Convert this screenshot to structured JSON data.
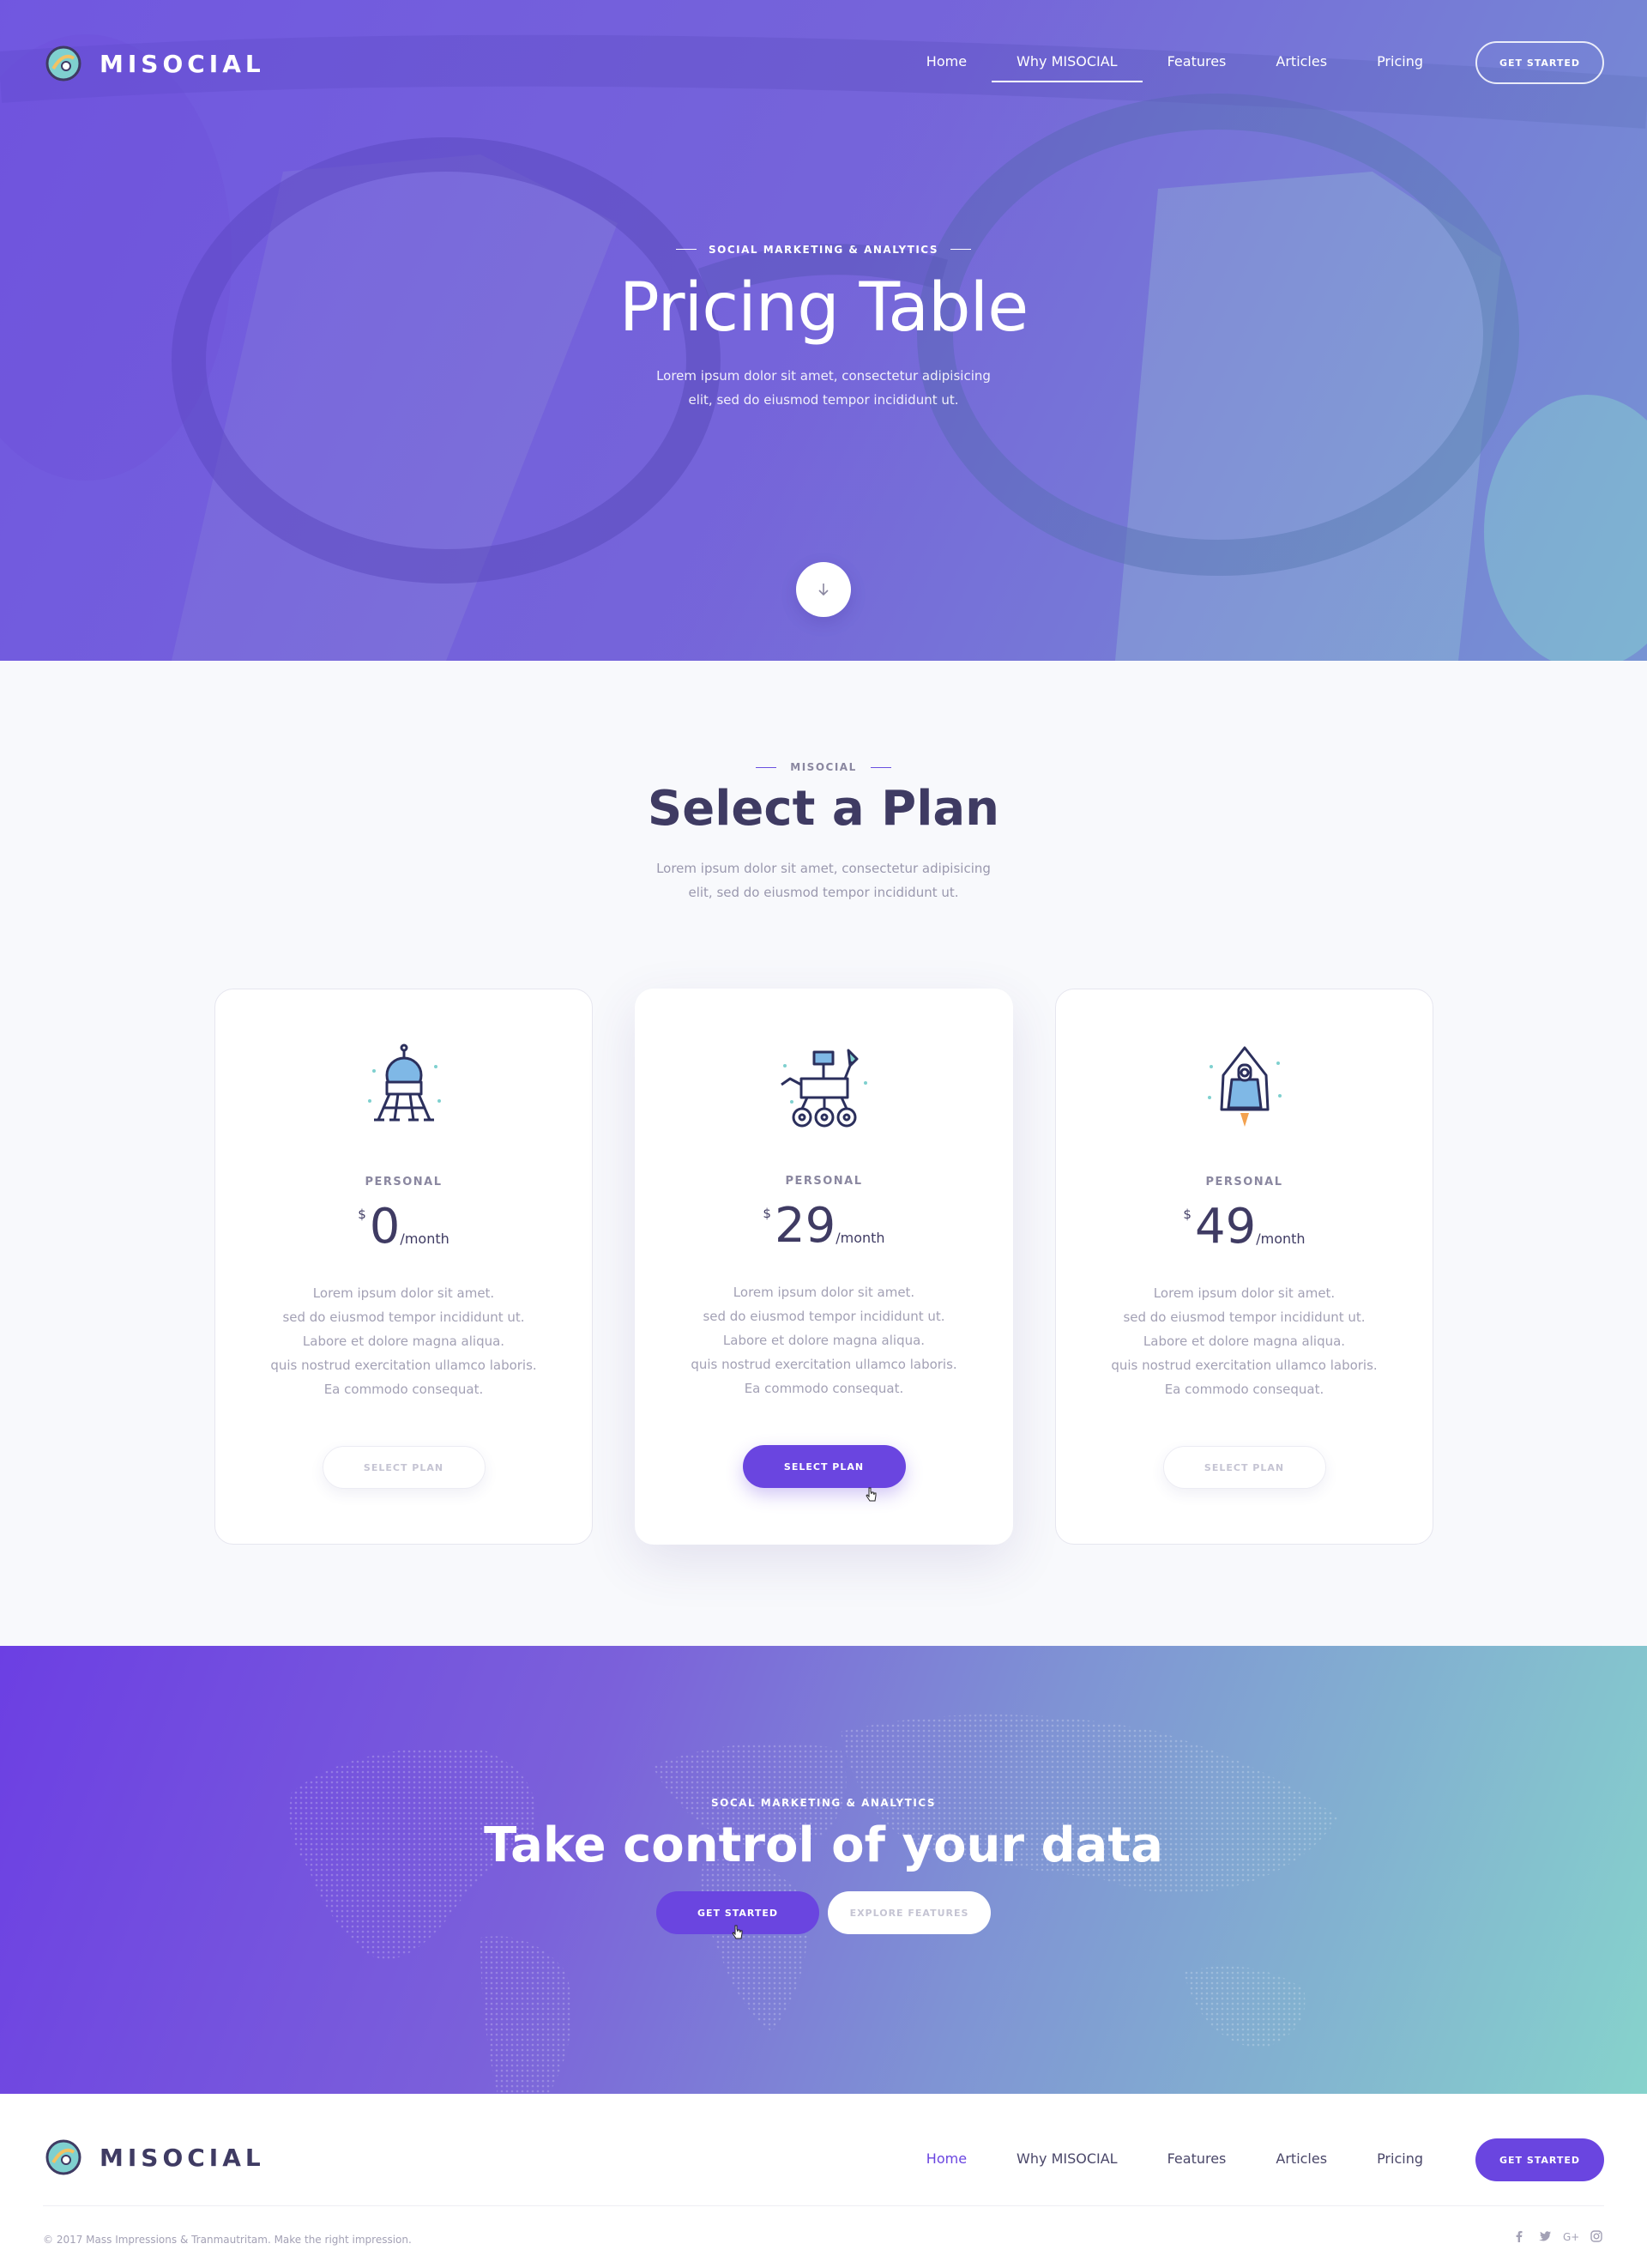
{
  "brand": {
    "name": "MISOCIAL"
  },
  "nav": {
    "items": [
      {
        "label": "Home"
      },
      {
        "label": "Why MISOCIAL"
      },
      {
        "label": "Features"
      },
      {
        "label": "Articles"
      },
      {
        "label": "Pricing"
      }
    ],
    "cta_label": "GET STARTED"
  },
  "hero": {
    "eyebrow": "SOCIAL MARKETING & ANALYTICS",
    "title": "Pricing Table",
    "subtitle_line1": "Lorem ipsum dolor sit amet, consectetur adipisicing",
    "subtitle_line2": "elit, sed do eiusmod tempor incididunt ut.",
    "scroll_icon": "arrow-down-icon"
  },
  "plans": {
    "eyebrow": "MISOCIAL",
    "title": "Select a Plan",
    "subtitle_line1": "Lorem ipsum dolor sit amet, consectetur adipisicing",
    "subtitle_line2": "elit, sed do eiusmod tempor incididunt ut.",
    "cards": [
      {
        "icon": "lunar-lander-icon",
        "name": "PERSONAL",
        "currency": "$",
        "price": "0",
        "period": "/month",
        "features": [
          "Lorem ipsum dolor sit amet.",
          "sed do eiusmod tempor incididunt ut.",
          "Labore et dolore magna aliqua.",
          "quis nostrud exercitation ullamco laboris.",
          "Ea commodo consequat."
        ],
        "button": "SELECT PLAN"
      },
      {
        "icon": "mars-rover-icon",
        "name": "PERSONAL",
        "currency": "$",
        "price": "29",
        "period": "/month",
        "features": [
          "Lorem ipsum dolor sit amet.",
          "sed do eiusmod tempor incididunt ut.",
          "Labore et dolore magna aliqua.",
          "quis nostrud exercitation ullamco laboris.",
          "Ea commodo consequat."
        ],
        "button": "SELECT PLAN"
      },
      {
        "icon": "space-capsule-icon",
        "name": "PERSONAL",
        "currency": "$",
        "price": "49",
        "period": "/month",
        "features": [
          "Lorem ipsum dolor sit amet.",
          "sed do eiusmod tempor incididunt ut.",
          "Labore et dolore magna aliqua.",
          "quis nostrud exercitation ullamco laboris.",
          "Ea commodo consequat."
        ],
        "button": "SELECT PLAN"
      }
    ]
  },
  "cta": {
    "eyebrow": "SOCAL MARKETING & ANALYTICS",
    "title": "Take control of your data",
    "primary": "GET STARTED",
    "secondary": "EXPLORE FEATURES"
  },
  "footer": {
    "copyright": "© 2017 Mass Impressions & Tranmautritam. Make the right impression.",
    "socials": [
      "facebook-icon",
      "twitter-icon",
      "google-plus-icon",
      "instagram-icon"
    ]
  },
  "colors": {
    "accent": "#6a45e0",
    "text": "#3f3b63",
    "muted": "#a3a1b5",
    "teal": "#86d3cc"
  }
}
